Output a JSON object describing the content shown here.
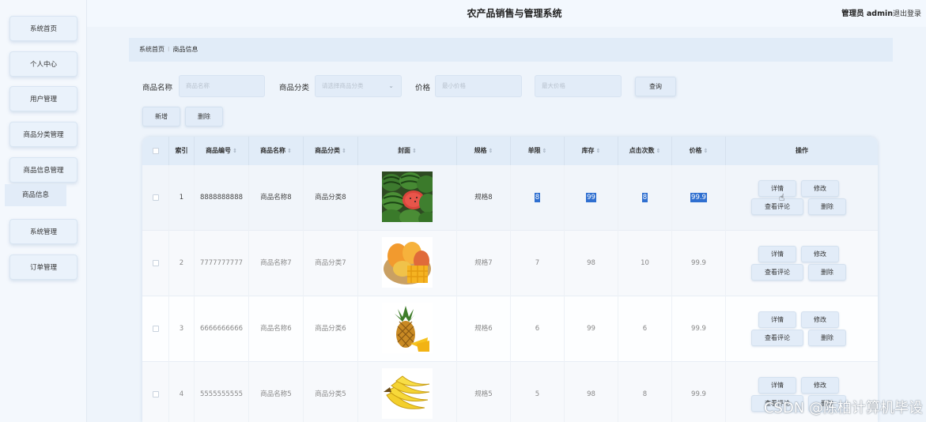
{
  "app": {
    "title": "农产品销售与管理系统",
    "user_label": "管理员 admin",
    "logout_label": "退出登录"
  },
  "sidebar": {
    "items": [
      {
        "label": "系统首页"
      },
      {
        "label": "个人中心"
      },
      {
        "label": "用户管理"
      },
      {
        "label": "商品分类管理"
      },
      {
        "label": "商品信息管理"
      },
      {
        "label": "系统管理"
      },
      {
        "label": "订单管理"
      }
    ],
    "subitem": {
      "label": "商品信息"
    }
  },
  "breadcrumb": {
    "home": "系统首页",
    "separator": "⁝",
    "current": "商品信息"
  },
  "search": {
    "name_label": "商品名称",
    "name_placeholder": "商品名称",
    "category_label": "商品分类",
    "category_placeholder": "请选择商品分类",
    "price_label": "价格",
    "min_price_placeholder": "最小价格",
    "max_price_placeholder": "最大价格",
    "query_label": "查询"
  },
  "toolbar": {
    "add_label": "新增",
    "delete_label": "删除"
  },
  "table": {
    "columns": [
      "索引",
      "商品编号",
      "商品名称",
      "商品分类",
      "封面",
      "规格",
      "单限",
      "库存",
      "点击次数",
      "价格",
      "操作"
    ],
    "sort_icon": "⇕",
    "rows": [
      {
        "index": "1",
        "code": "8888888888",
        "name": "商品名称8",
        "category": "商品分类8",
        "cover": "watermelon",
        "spec": "规格8",
        "limit": "8",
        "stock": "99",
        "clicks": "8",
        "price": "99.9"
      },
      {
        "index": "2",
        "code": "7777777777",
        "name": "商品名称7",
        "category": "商品分类7",
        "cover": "mango",
        "spec": "规格7",
        "limit": "7",
        "stock": "98",
        "clicks": "10",
        "price": "99.9"
      },
      {
        "index": "3",
        "code": "6666666666",
        "name": "商品名称6",
        "category": "商品分类6",
        "cover": "pineapple",
        "spec": "规格6",
        "limit": "6",
        "stock": "99",
        "clicks": "6",
        "price": "99.9"
      },
      {
        "index": "4",
        "code": "5555555555",
        "name": "商品名称5",
        "category": "商品分类5",
        "cover": "banana",
        "spec": "规格5",
        "limit": "5",
        "stock": "98",
        "clicks": "8",
        "price": "99.9"
      }
    ],
    "actions": {
      "detail": "详情",
      "edit": "修改",
      "comments": "查看评论",
      "delete": "删除"
    }
  },
  "watermark": "CSDN @陈柏计算机毕设",
  "colors": {
    "accent_bg": "#e2ecf8",
    "highlight": "#2f6fd0"
  }
}
